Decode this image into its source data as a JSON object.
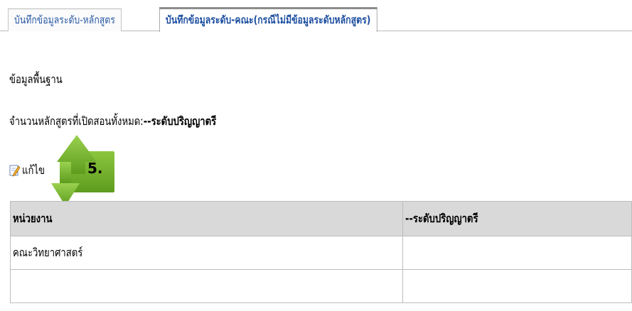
{
  "tabs": [
    {
      "label": "บันทึกข้อมูลระดับ-หลักสูตร",
      "active": false
    },
    {
      "label": "บันทึกข้อมูลระดับ-คณะ(กรณีไม่มีข้อมูลระดับหลักสูตร)",
      "active": true
    }
  ],
  "section_title": "ข้อมูลพื้นฐาน",
  "course_count": {
    "label": "จำนวนหลักสูตรที่เปิดสอนทั้งหมด:",
    "value": "--ระดับปริญญาตรี"
  },
  "edit_button": {
    "label": "แก้ไข",
    "icon": "edit-pencil-icon"
  },
  "annotation": {
    "step_label": "5.",
    "color": "#7ab536"
  },
  "table": {
    "headers": [
      "หน่วยงาน",
      "--ระดับปริญญาตรี"
    ],
    "rows": [
      [
        "คณะวิทยาศาสตร์",
        ""
      ],
      [
        "",
        ""
      ]
    ]
  }
}
